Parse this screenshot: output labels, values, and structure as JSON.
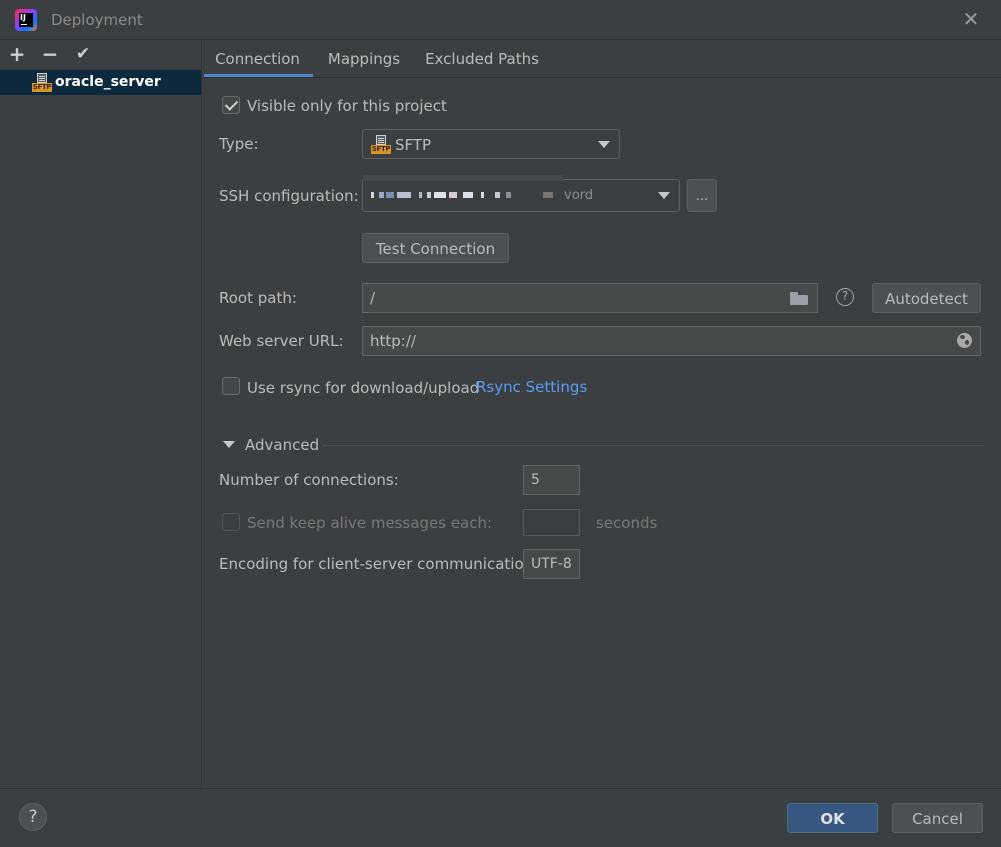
{
  "window": {
    "title": "Deployment"
  },
  "left": {
    "toolbar": {
      "add": "+",
      "remove": "−",
      "apply": "✔"
    },
    "servers": [
      {
        "name": "oracle_server",
        "icon": "sftp-server-icon"
      }
    ]
  },
  "tabs": [
    {
      "label": "Connection",
      "active": true
    },
    {
      "label": "Mappings"
    },
    {
      "label": "Excluded Paths"
    }
  ],
  "connection": {
    "visible_only": {
      "label": "Visible only for this project",
      "checked": true
    },
    "type": {
      "label": "Type:",
      "value": "SFTP"
    },
    "ssh": {
      "label": "SSH configuration:",
      "value_suffix": "vord",
      "more_button": "..."
    },
    "test_button": "Test Connection",
    "root_path": {
      "label": "Root path:",
      "value": "/",
      "autodetect": "Autodetect"
    },
    "web_url": {
      "label": "Web server URL:",
      "value": "http://"
    },
    "rsync": {
      "label": "Use rsync for download/upload",
      "checked": false,
      "settings_link": "Rsync Settings"
    },
    "advanced": {
      "title": "Advanced",
      "connections": {
        "label": "Number of connections:",
        "value": "5"
      },
      "keep_alive": {
        "label": "Send keep alive messages each:",
        "value": "",
        "unit": "seconds",
        "enabled": false
      },
      "encoding": {
        "label": "Encoding for client-server communication:",
        "value": "UTF-8"
      }
    }
  },
  "footer": {
    "help": "?",
    "ok": "OK",
    "cancel": "Cancel"
  },
  "colors": {
    "background": "#3c3f41",
    "selection": "#0d293e",
    "accent": "#4a88c7",
    "link": "#589df6",
    "ok_button": "#365880"
  }
}
